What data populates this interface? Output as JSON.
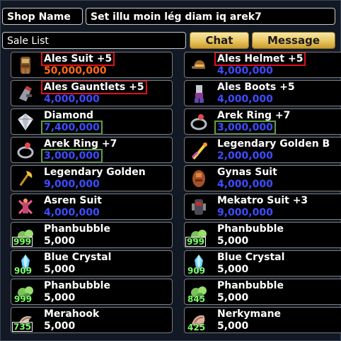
{
  "shop": {
    "name_label": "Shop Name",
    "name_value": "Set illu moin lég diam iq arek7",
    "sale_list_label": "Sale List",
    "chat_label": "Chat",
    "message_label": "Message"
  },
  "colors": {
    "price_orange": "#ff6a1a",
    "price_blue": "#3d4dff",
    "price_white": "#ffffff",
    "highlight_red": "#e0101a",
    "highlight_green": "#5ea144",
    "button_gold": "#e8c55f"
  },
  "items": [
    {
      "name": "Ales Suit +5",
      "price": "50,000,000",
      "price_color": "orange",
      "icon": "armor-suit-icon",
      "qty": "",
      "name_hl": "red",
      "price_hl": ""
    },
    {
      "name": "Ales Helmet +5",
      "price": "4,000,000",
      "price_color": "blue",
      "icon": "helmet-icon",
      "qty": "",
      "name_hl": "red",
      "price_hl": ""
    },
    {
      "name": "Ales Gauntlets +5",
      "price": "4,000,000",
      "price_color": "blue",
      "icon": "gauntlet-icon",
      "qty": "",
      "name_hl": "red",
      "price_hl": ""
    },
    {
      "name": "Ales Boots +5",
      "price": "4,000,000",
      "price_color": "blue",
      "icon": "boots-icon",
      "qty": "",
      "name_hl": "",
      "price_hl": ""
    },
    {
      "name": "Diamond",
      "price": "7,400,000",
      "price_color": "blue",
      "icon": "diamond-icon",
      "qty": "",
      "name_hl": "",
      "price_hl": "green"
    },
    {
      "name": "Arek Ring +7",
      "price": "3,000,000",
      "price_color": "blue",
      "icon": "ring-icon",
      "qty": "",
      "name_hl": "",
      "price_hl": "green"
    },
    {
      "name": "Arek Ring +7",
      "price": "3,000,000",
      "price_color": "blue",
      "icon": "ring-icon",
      "qty": "",
      "name_hl": "",
      "price_hl": "green"
    },
    {
      "name": "Legendary Golden B",
      "price": "2,000,000",
      "price_color": "blue",
      "icon": "golden-sword-icon",
      "qty": "",
      "name_hl": "",
      "price_hl": ""
    },
    {
      "name": "Legendary Golden",
      "price": "9,000,000",
      "price_color": "blue",
      "icon": "golden-axe-icon",
      "qty": "",
      "name_hl": "",
      "price_hl": ""
    },
    {
      "name": "Gynas Suit",
      "price": "4,000,000",
      "price_color": "blue",
      "icon": "gynas-suit-icon",
      "qty": "",
      "name_hl": "",
      "price_hl": ""
    },
    {
      "name": "Asren Suit",
      "price": "4,000,000",
      "price_color": "blue",
      "icon": "asren-suit-icon",
      "qty": "",
      "name_hl": "",
      "price_hl": ""
    },
    {
      "name": "Mekatro Suit +3",
      "price": "9,000,000",
      "price_color": "blue",
      "icon": "mekatro-suit-icon",
      "qty": "",
      "name_hl": "",
      "price_hl": ""
    },
    {
      "name": "Phanbubble",
      "price": "5,000",
      "price_color": "white",
      "icon": "phanbubble-icon",
      "qty": "999",
      "qty_boxed": true,
      "name_hl": "",
      "price_hl": ""
    },
    {
      "name": "Phanbubble",
      "price": "5,000",
      "price_color": "white",
      "icon": "phanbubble-icon",
      "qty": "999",
      "qty_boxed": true,
      "name_hl": "",
      "price_hl": ""
    },
    {
      "name": "Blue Crystal",
      "price": "5,000",
      "price_color": "white",
      "icon": "blue-crystal-icon",
      "qty": "909",
      "name_hl": "",
      "price_hl": ""
    },
    {
      "name": "Blue Crystal",
      "price": "5,000",
      "price_color": "white",
      "icon": "blue-crystal-icon",
      "qty": "909",
      "name_hl": "",
      "price_hl": ""
    },
    {
      "name": "Phanbubble",
      "price": "5,000",
      "price_color": "white",
      "icon": "phanbubble-icon",
      "qty": "999",
      "name_hl": "",
      "price_hl": ""
    },
    {
      "name": "Phanbubble",
      "price": "5,000",
      "price_color": "white",
      "icon": "phanbubble-icon",
      "qty": "845",
      "name_hl": "",
      "price_hl": ""
    },
    {
      "name": "Merahook",
      "price": "5,000",
      "price_color": "white",
      "icon": "merahook-icon",
      "qty": "735",
      "qty_boxed": true,
      "name_hl": "",
      "price_hl": ""
    },
    {
      "name": "Nerkymane",
      "price": "5,000",
      "price_color": "white",
      "icon": "nerkymane-icon",
      "qty": "425",
      "name_hl": "",
      "price_hl": ""
    }
  ]
}
